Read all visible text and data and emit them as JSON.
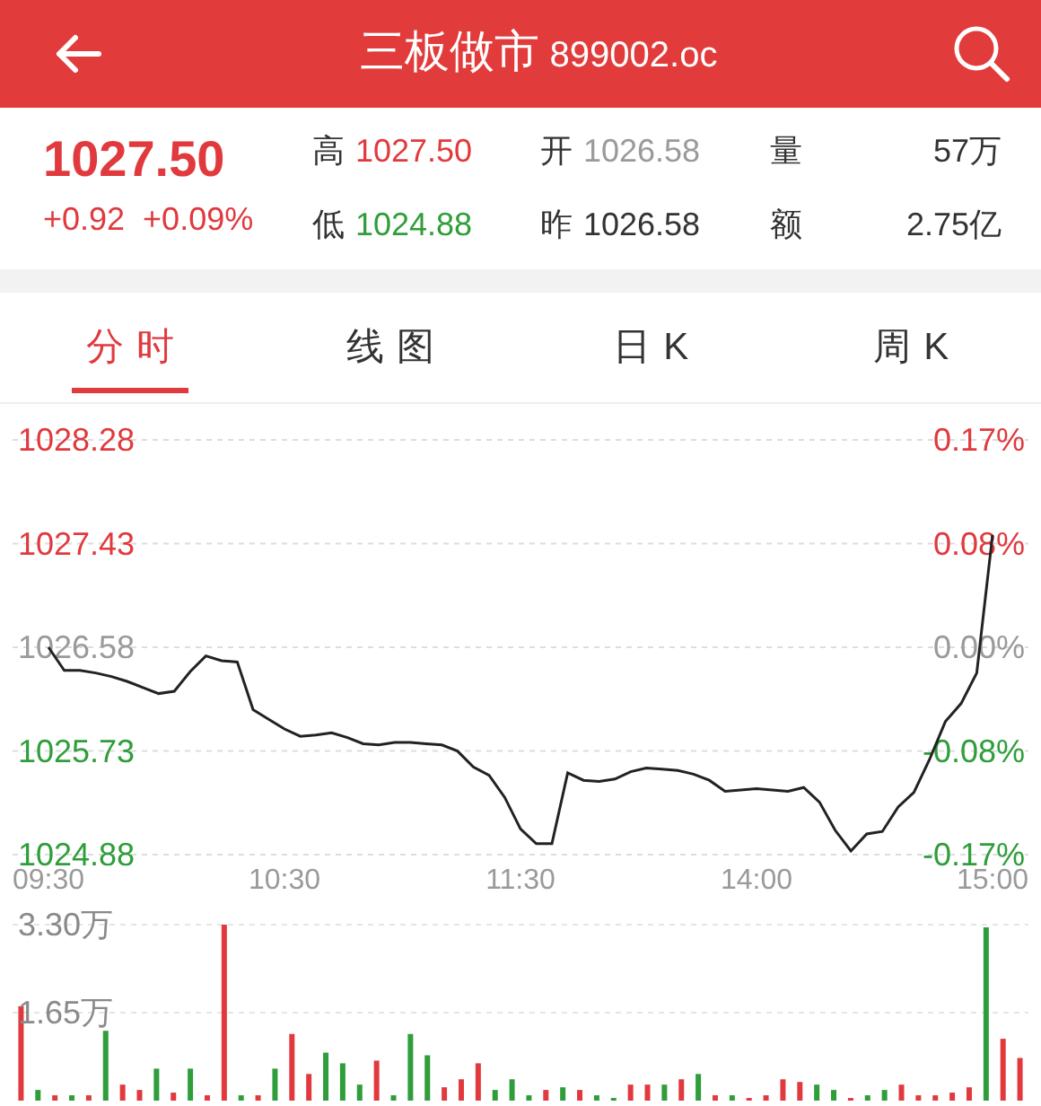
{
  "header": {
    "title": "三板做市",
    "code": "899002.oc"
  },
  "quote": {
    "price": "1027.50",
    "change": "+0.92",
    "change_pct": "+0.09%",
    "stats": [
      {
        "label": "高",
        "value": "1027.50",
        "color": "#e03a3e"
      },
      {
        "label": "开",
        "value": "1026.58",
        "color": "#9a9a9a"
      },
      {
        "label": "量",
        "value": "57万",
        "color": "#333333"
      },
      {
        "label": "低",
        "value": "1024.88",
        "color": "#2f9e3a"
      },
      {
        "label": "昨",
        "value": "1026.58",
        "color": "#333333"
      },
      {
        "label": "额",
        "value": "2.75亿",
        "color": "#333333"
      }
    ]
  },
  "tabs": [
    {
      "label": "分时",
      "selected": true
    },
    {
      "label": "线图",
      "selected": false
    },
    {
      "label": "日K",
      "selected": false
    },
    {
      "label": "周K",
      "selected": false
    }
  ],
  "price_chart": {
    "pct_labels": [
      "0.17%",
      "0.08%",
      "0.00%",
      "-0.08%",
      "-0.17%"
    ],
    "chart_data": {
      "type": "line",
      "grid": true,
      "ylim": [
        1024.88,
        1028.28
      ],
      "yticks": [
        1028.28,
        1027.43,
        1026.58,
        1025.73,
        1024.88
      ],
      "categories": [
        "09:30",
        null,
        null,
        null,
        null,
        null,
        null,
        null,
        null,
        null,
        null,
        null,
        null,
        null,
        null,
        "10:30",
        null,
        null,
        null,
        null,
        null,
        null,
        null,
        null,
        null,
        null,
        null,
        null,
        null,
        null,
        "11:30",
        null,
        null,
        null,
        null,
        null,
        null,
        null,
        null,
        null,
        null,
        null,
        null,
        null,
        null,
        "14:00",
        null,
        null,
        null,
        null,
        null,
        null,
        null,
        null,
        null,
        null,
        null,
        null,
        null,
        null,
        "15:00"
      ],
      "series": [
        {
          "color": "#222222",
          "values": [
            1026.58,
            1026.39,
            1026.39,
            1026.37,
            1026.34,
            1026.3,
            1026.25,
            1026.2,
            1026.22,
            1026.38,
            1026.51,
            1026.47,
            1026.46,
            1026.07,
            1025.99,
            1025.91,
            1025.85,
            1025.86,
            1025.88,
            1025.84,
            1025.79,
            1025.78,
            1025.8,
            1025.8,
            1025.79,
            1025.78,
            1025.73,
            1025.6,
            1025.53,
            1025.35,
            1025.09,
            1024.97,
            1024.97,
            1025.55,
            1025.49,
            1025.48,
            1025.5,
            1025.56,
            1025.59,
            1025.58,
            1025.57,
            1025.54,
            1025.49,
            1025.4,
            1025.41,
            1025.42,
            1025.41,
            1025.4,
            1025.43,
            1025.31,
            1025.08,
            1024.91,
            1025.05,
            1025.07,
            1025.27,
            1025.39,
            1025.66,
            1025.97,
            1026.12,
            1026.37,
            1027.5
          ]
        }
      ]
    }
  },
  "volume_chart": {
    "chart_data": {
      "type": "bar",
      "stacked": true,
      "ylim": [
        0,
        3.3
      ],
      "yticks": [
        {
          "value": 3.3,
          "label": "3.30万"
        },
        {
          "value": 1.65,
          "label": "1.65万"
        }
      ],
      "categories": [
        null,
        null,
        null,
        null,
        null,
        null,
        null,
        null,
        null,
        null,
        null,
        null,
        null,
        null,
        null,
        null,
        null,
        null,
        null,
        null,
        null,
        null,
        null,
        null,
        null,
        null,
        null,
        null,
        null,
        null,
        null,
        null,
        null,
        null,
        null,
        null,
        null,
        null,
        null,
        null,
        null,
        null,
        null,
        null,
        null,
        null,
        null,
        null,
        null,
        null,
        null,
        null,
        null,
        null,
        null,
        null,
        null,
        null,
        null,
        null
      ],
      "series": [
        {
          "color": "#e03a3e",
          "values": [
            1.77,
            null,
            0.1,
            null,
            0.1,
            null,
            0.3,
            0.2,
            null,
            0.15,
            null,
            0.1,
            3.3,
            null,
            0.1,
            null,
            1.25,
            0.5,
            null,
            null,
            null,
            0.75,
            null,
            null,
            null,
            0.25,
            0.4,
            0.7,
            null,
            null,
            null,
            0.2,
            null,
            0.2,
            null,
            null,
            0.3,
            0.3,
            null,
            0.4,
            null,
            0.1,
            null,
            0.05,
            0.1,
            0.4,
            0.35,
            null,
            null,
            0.05,
            null,
            null,
            0.3,
            0.1,
            0.1,
            0.15,
            0.25,
            null,
            1.16,
            0.8
          ]
        },
        {
          "color": "#2f9e3a",
          "values": [
            null,
            0.2,
            null,
            0.1,
            null,
            1.31,
            null,
            null,
            0.6,
            null,
            0.6,
            null,
            null,
            0.1,
            null,
            0.6,
            null,
            null,
            0.9,
            0.7,
            0.3,
            null,
            0.1,
            1.25,
            0.85,
            null,
            null,
            null,
            0.2,
            0.4,
            0.1,
            null,
            0.25,
            null,
            0.1,
            0.05,
            null,
            null,
            0.3,
            null,
            0.5,
            null,
            0.1,
            null,
            null,
            null,
            null,
            0.3,
            0.2,
            null,
            0.1,
            0.2,
            null,
            null,
            null,
            null,
            null,
            3.25,
            null,
            null
          ]
        }
      ]
    }
  }
}
